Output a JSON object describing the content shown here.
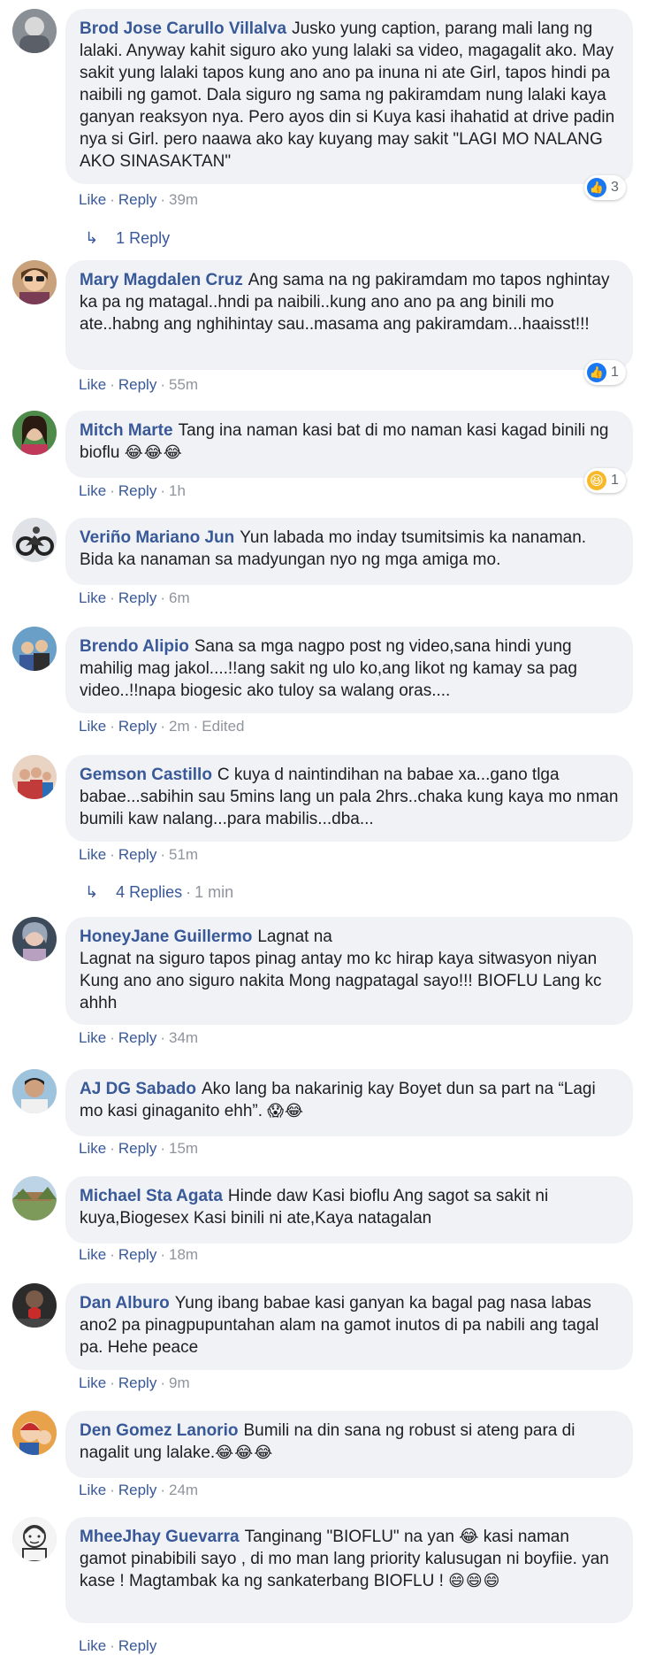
{
  "comments": [
    {
      "author": "Brod Jose Carullo Villalva",
      "text": "Jusko yung caption, parang mali lang ng lalaki. Anyway kahit siguro ako yung lalaki sa video, magagalit ako. May sakit yung lalaki tapos kung ano ano pa inuna ni ate Girl, tapos hindi pa naibili ng gamot. Dala siguro ng sama ng pakiramdam nung lalaki kaya ganyan reaksyon nya. Pero ayos din si Kuya kasi ihahatid at drive padin nya si Girl. pero naawa ako kay kuyang may sakit \"LAGI MO NALANG AKO SINASAKTAN\"",
      "emoji": "",
      "like": "Like",
      "reply": "Reply",
      "time": "39m",
      "reaction": {
        "icon": "like-icon",
        "count": "3"
      },
      "replies": {
        "label": "1 Reply",
        "time": ""
      }
    },
    {
      "author": "Mary Magdalen Cruz",
      "text": "Ang sama na ng pakiramdam mo tapos nghintay ka pa ng matagal..hndi pa naibili..kung ano ano pa ang binili mo ate..habng ang nghihintay sau..masama ang pakiramdam...haaisst!!!",
      "emoji": "",
      "like": "Like",
      "reply": "Reply",
      "time": "55m",
      "reaction": {
        "icon": "like-icon",
        "count": "1"
      }
    },
    {
      "author": "Mitch Marte",
      "text": "Tang ina naman kasi bat di mo naman kasi kagad binili ng bioflu ",
      "emoji": "😂😂😂",
      "like": "Like",
      "reply": "Reply",
      "time": "1h",
      "reaction": {
        "icon": "haha-icon",
        "count": "1"
      }
    },
    {
      "author": "Veriño Mariano Jun",
      "text": "Yun labada mo inday tsumitsimis ka nanaman. Bida ka nanaman sa madyungan nyo ng mga amiga mo.",
      "emoji": "",
      "like": "Like",
      "reply": "Reply",
      "time": "6m"
    },
    {
      "author": "Brendo Alipio",
      "text": "Sana sa mga nagpo post ng video,sana hindi yung mahilig mag jakol....!!ang sakit ng ulo ko,ang likot ng kamay sa pag video..!!napa biogesic ako tuloy sa walang oras....",
      "emoji": "",
      "like": "Like",
      "reply": "Reply",
      "time": "2m",
      "edited": "Edited"
    },
    {
      "author": "Gemson Castillo",
      "text": "C kuya d naintindihan na babae xa...gano tlga babae...sabihin sau 5mins lang un pala 2hrs..chaka kung kaya mo nman bumili kaw nalang...para mabilis...dba...",
      "emoji": "",
      "like": "Like",
      "reply": "Reply",
      "time": "51m",
      "replies": {
        "label": "4 Replies",
        "time": "1 min"
      }
    },
    {
      "author": "HoneyJane Guillermo",
      "text": "Lagnat na\nLagnat na siguro tapos pinag antay mo kc hirap kaya sitwasyon niyan Kung ano ano siguro nakita Mong nagpatagal sayo!!! BIOFLU Lang kc ahhh",
      "emoji": "",
      "like": "Like",
      "reply": "Reply",
      "time": "34m"
    },
    {
      "author": "AJ DG Sabado",
      "text": "Ako lang ba nakarinig kay Boyet dun sa part na “Lagi mo kasi ginaganito ehh”. ",
      "emoji": "😱😂",
      "like": "Like",
      "reply": "Reply",
      "time": "15m"
    },
    {
      "author": "Michael Sta Agata",
      "text": "Hinde daw Kasi bioflu Ang sagot sa sakit ni kuya,Biogesex Kasi binili ni ate,Kaya natagalan",
      "emoji": "",
      "like": "Like",
      "reply": "Reply",
      "time": "18m"
    },
    {
      "author": "Dan Alburo",
      "text": "Yung ibang babae kasi ganyan ka bagal pag nasa labas ano2 pa pinagpupuntahan alam na gamot inutos di pa nabili ang tagal pa. Hehe peace",
      "emoji": "",
      "like": "Like",
      "reply": "Reply",
      "time": "9m"
    },
    {
      "author": "Den Gomez Lanorio",
      "text": "Bumili na din sana ng robust si ateng para di nagalit ung lalake.",
      "emoji": "😂😂😂",
      "like": "Like",
      "reply": "Reply",
      "time": "24m"
    },
    {
      "author": "MheeJhay Guevarra",
      "text": "Tanginang \"BIOFLU\" na yan 😂 kasi naman gamot pinabibili sayo , di mo man lang priority kalusugan ni boyfiie. yan kase ! Magtambak ka ng sankaterbang BIOFLU ! ",
      "emoji": "😄😄😄",
      "like": "Like",
      "reply": "Reply",
      "time": ""
    }
  ],
  "colors": {
    "author": "#385898",
    "bubble": "#f0f2f5",
    "meta": "#606770",
    "like_blue": "#1877f2"
  }
}
